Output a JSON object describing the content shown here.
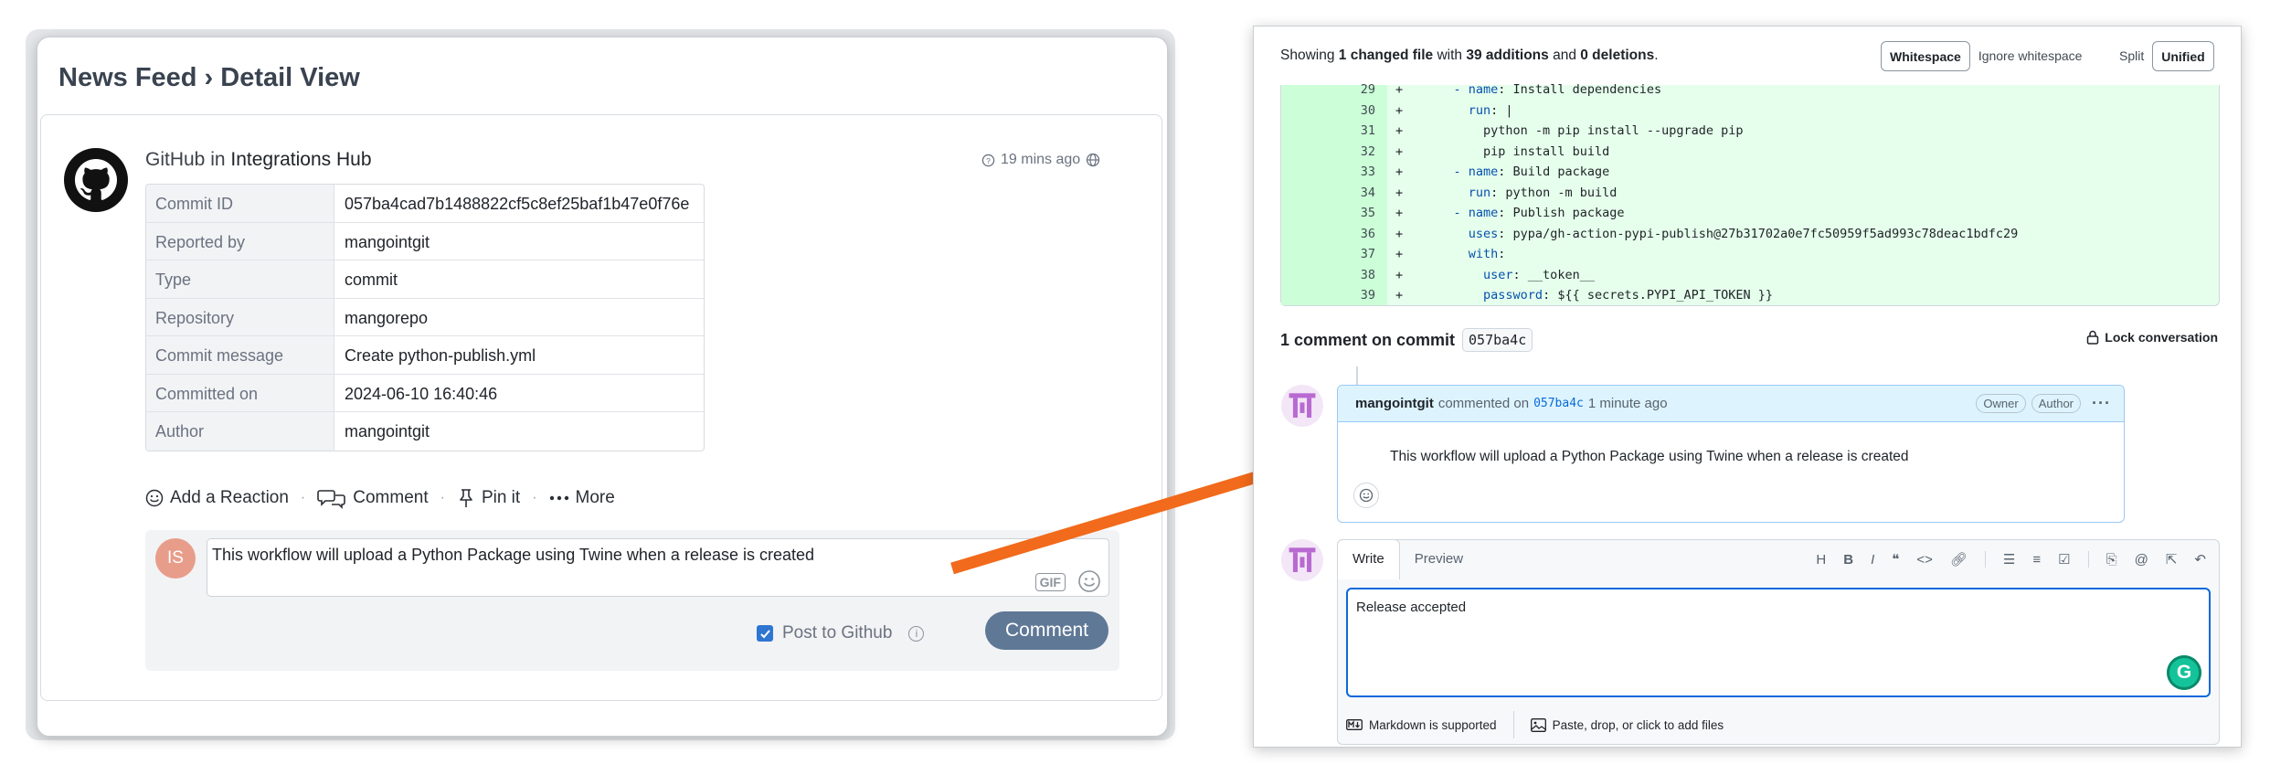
{
  "news_feed": {
    "title": "News Feed › Detail View",
    "author": "GitHub",
    "in_word": "in",
    "channel": "Integrations Hub",
    "time_ago": "19 mins ago",
    "details": [
      {
        "key": "Commit ID",
        "value": "057ba4cad7b1488822cf5c8ef25baf1b47e0f76e"
      },
      {
        "key": "Reported by",
        "value": "mangointgit"
      },
      {
        "key": "Type",
        "value": "commit"
      },
      {
        "key": "Repository",
        "value": "mangorepo"
      },
      {
        "key": "Commit message",
        "value": "Create python-publish.yml"
      },
      {
        "key": "Committed on",
        "value": "2024-06-10 16:40:46"
      },
      {
        "key": "Author",
        "value": "mangointgit"
      }
    ],
    "actions": {
      "reaction": "Add a Reaction",
      "comment": "Comment",
      "pin": "Pin it",
      "more": "More"
    },
    "composer": {
      "avatar_initials": "IS",
      "text": "This workflow will upload a Python Package using Twine when a release is created",
      "gif": "GIF",
      "post_label": "Post to Github",
      "button": "Comment"
    }
  },
  "github": {
    "summary": {
      "pre": "Showing ",
      "files": "1 changed file",
      "mid": " with ",
      "adds": "39 additions",
      "and": " and ",
      "dels": "0 deletions",
      "end": "."
    },
    "whitespace_toggle": [
      "Whitespace",
      "Ignore whitespace"
    ],
    "view_toggle": [
      "Split",
      "Unified"
    ],
    "diff_lines": [
      {
        "n": "29",
        "indent": "    ",
        "key": "- name",
        "rest": ": Install dependencies"
      },
      {
        "n": "30",
        "indent": "      ",
        "key": "run",
        "rest": ": |"
      },
      {
        "n": "31",
        "indent": "        ",
        "key": "",
        "rest": "python -m pip install --upgrade pip"
      },
      {
        "n": "32",
        "indent": "        ",
        "key": "",
        "rest": "pip install build"
      },
      {
        "n": "33",
        "indent": "    ",
        "key": "- name",
        "rest": ": Build package"
      },
      {
        "n": "34",
        "indent": "      ",
        "key": "run",
        "rest": ": python -m build"
      },
      {
        "n": "35",
        "indent": "    ",
        "key": "- name",
        "rest": ": Publish package"
      },
      {
        "n": "36",
        "indent": "      ",
        "key": "uses",
        "rest": ": pypa/gh-action-pypi-publish@27b31702a0e7fc50959f5ad993c78deac1bdfc29"
      },
      {
        "n": "37",
        "indent": "      ",
        "key": "with",
        "rest": ":"
      },
      {
        "n": "38",
        "indent": "        ",
        "key": "user",
        "rest": ": __token__"
      },
      {
        "n": "39",
        "indent": "        ",
        "key": "password",
        "rest": ": ${{ secrets.PYPI_API_TOKEN }}"
      }
    ],
    "diff_plus": "+",
    "comments_title": "1 comment on commit",
    "commit_sha": "057ba4c",
    "lock_label": "Lock conversation",
    "comment": {
      "user": "mangointgit",
      "action": "commented on",
      "sha": "057ba4c",
      "time": "1 minute ago",
      "badges": [
        "Owner",
        "Author"
      ],
      "body": "This workflow will upload a Python Package using Twine when a release is created"
    },
    "editor": {
      "tabs": [
        "Write",
        "Preview"
      ],
      "value": "Release accepted",
      "markdown_note": "Markdown is supported",
      "attach_note": "Paste, drop, or click to add files"
    }
  }
}
